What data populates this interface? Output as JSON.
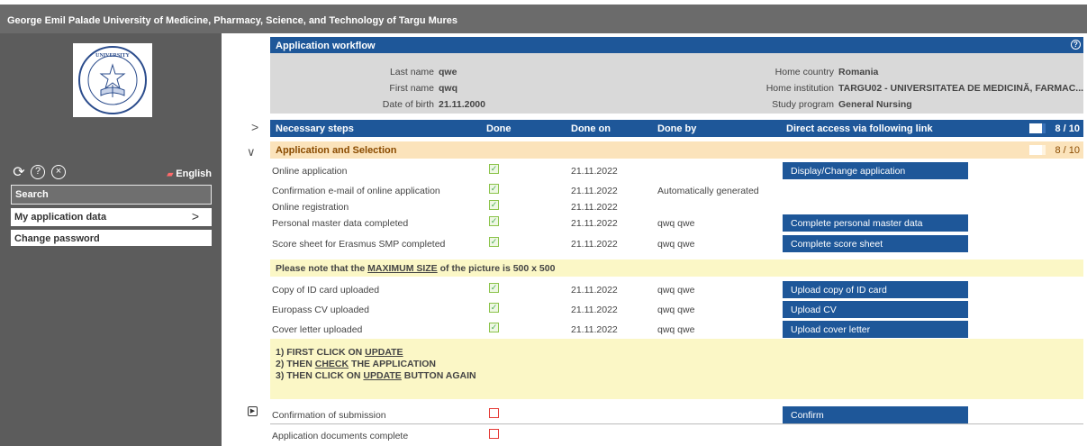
{
  "header": {
    "title": "George Emil Palade University of Medicine, Pharmacy, Science, and Technology of Targu Mures"
  },
  "sidebar": {
    "logo_icon": "university-seal",
    "logo_text": "UNIVERSITY",
    "language": "English",
    "items": [
      {
        "label": "Search"
      },
      {
        "label": "My application data"
      },
      {
        "label": "Change password"
      }
    ]
  },
  "workflow": {
    "title": "Application workflow",
    "person": {
      "last_name_label": "Last name",
      "last_name": "qwe",
      "first_name_label": "First name",
      "first_name": "qwq",
      "dob_label": "Date of birth",
      "dob": "21.11.2000",
      "home_country_label": "Home country",
      "home_country": "Romania",
      "home_institution_label": "Home institution",
      "home_institution": "TARGU02 - UNIVERSITATEA DE MEDICINĂ, FARMAC...",
      "study_program_label": "Study program",
      "study_program": "General Nursing"
    },
    "columns": {
      "steps": "Necessary steps",
      "done": "Done",
      "done_on": "Done on",
      "done_by": "Done by",
      "link": "Direct access via following link",
      "progress": "8 / 10",
      "progress_fraction": 0.8
    },
    "section": {
      "title": "Application and Selection",
      "progress": "8 / 10",
      "progress_fraction": 0.8
    },
    "rows": [
      {
        "label": "Online application",
        "done": true,
        "done_on": "21.11.2022",
        "done_by": "",
        "button": "Display/Change application"
      },
      {
        "label": "Confirmation e-mail of online application",
        "done": true,
        "done_on": "21.11.2022",
        "done_by": "Automatically generated",
        "button": ""
      },
      {
        "label": "Online registration",
        "done": true,
        "done_on": "21.11.2022",
        "done_by": "",
        "button": ""
      },
      {
        "label": "Personal master data completed",
        "done": true,
        "done_on": "21.11.2022",
        "done_by": "qwq qwe",
        "button": "Complete personal master data"
      },
      {
        "label": "Score sheet for Erasmus SMP completed",
        "done": true,
        "done_on": "21.11.2022",
        "done_by": "qwq qwe",
        "button": "Complete score sheet"
      },
      {
        "label": "Copy of ID card uploaded",
        "done": true,
        "done_on": "21.11.2022",
        "done_by": "qwq qwe",
        "button": "Upload copy of ID card"
      },
      {
        "label": "Europass CV uploaded",
        "done": true,
        "done_on": "21.11.2022",
        "done_by": "qwq qwe",
        "button": "Upload CV"
      },
      {
        "label": "Cover letter uploaded",
        "done": true,
        "done_on": "21.11.2022",
        "done_by": "qwq qwe",
        "button": "Upload cover letter"
      },
      {
        "label": "Confirmation of submission",
        "done": false,
        "done_on": "",
        "done_by": "",
        "button": "Confirm"
      },
      {
        "label": "Application documents complete",
        "done": false,
        "done_on": "",
        "done_by": "",
        "button": ""
      }
    ],
    "note1": {
      "pre": "Please note that the ",
      "em": "MAXIMUM SIZE",
      "post": " of the picture is 500 x 500"
    },
    "note2": {
      "l1_pre": "1) FIRST CLICK ON ",
      "l1_em": "UPDATE",
      "l2_pre": "2) THEN ",
      "l2_em": "CHECK",
      "l2_post": " THE APPLICATION",
      "l3_pre": "3) THEN CLICK ON ",
      "l3_em": "UPDATE",
      "l3_post": " BUTTON AGAIN"
    }
  }
}
